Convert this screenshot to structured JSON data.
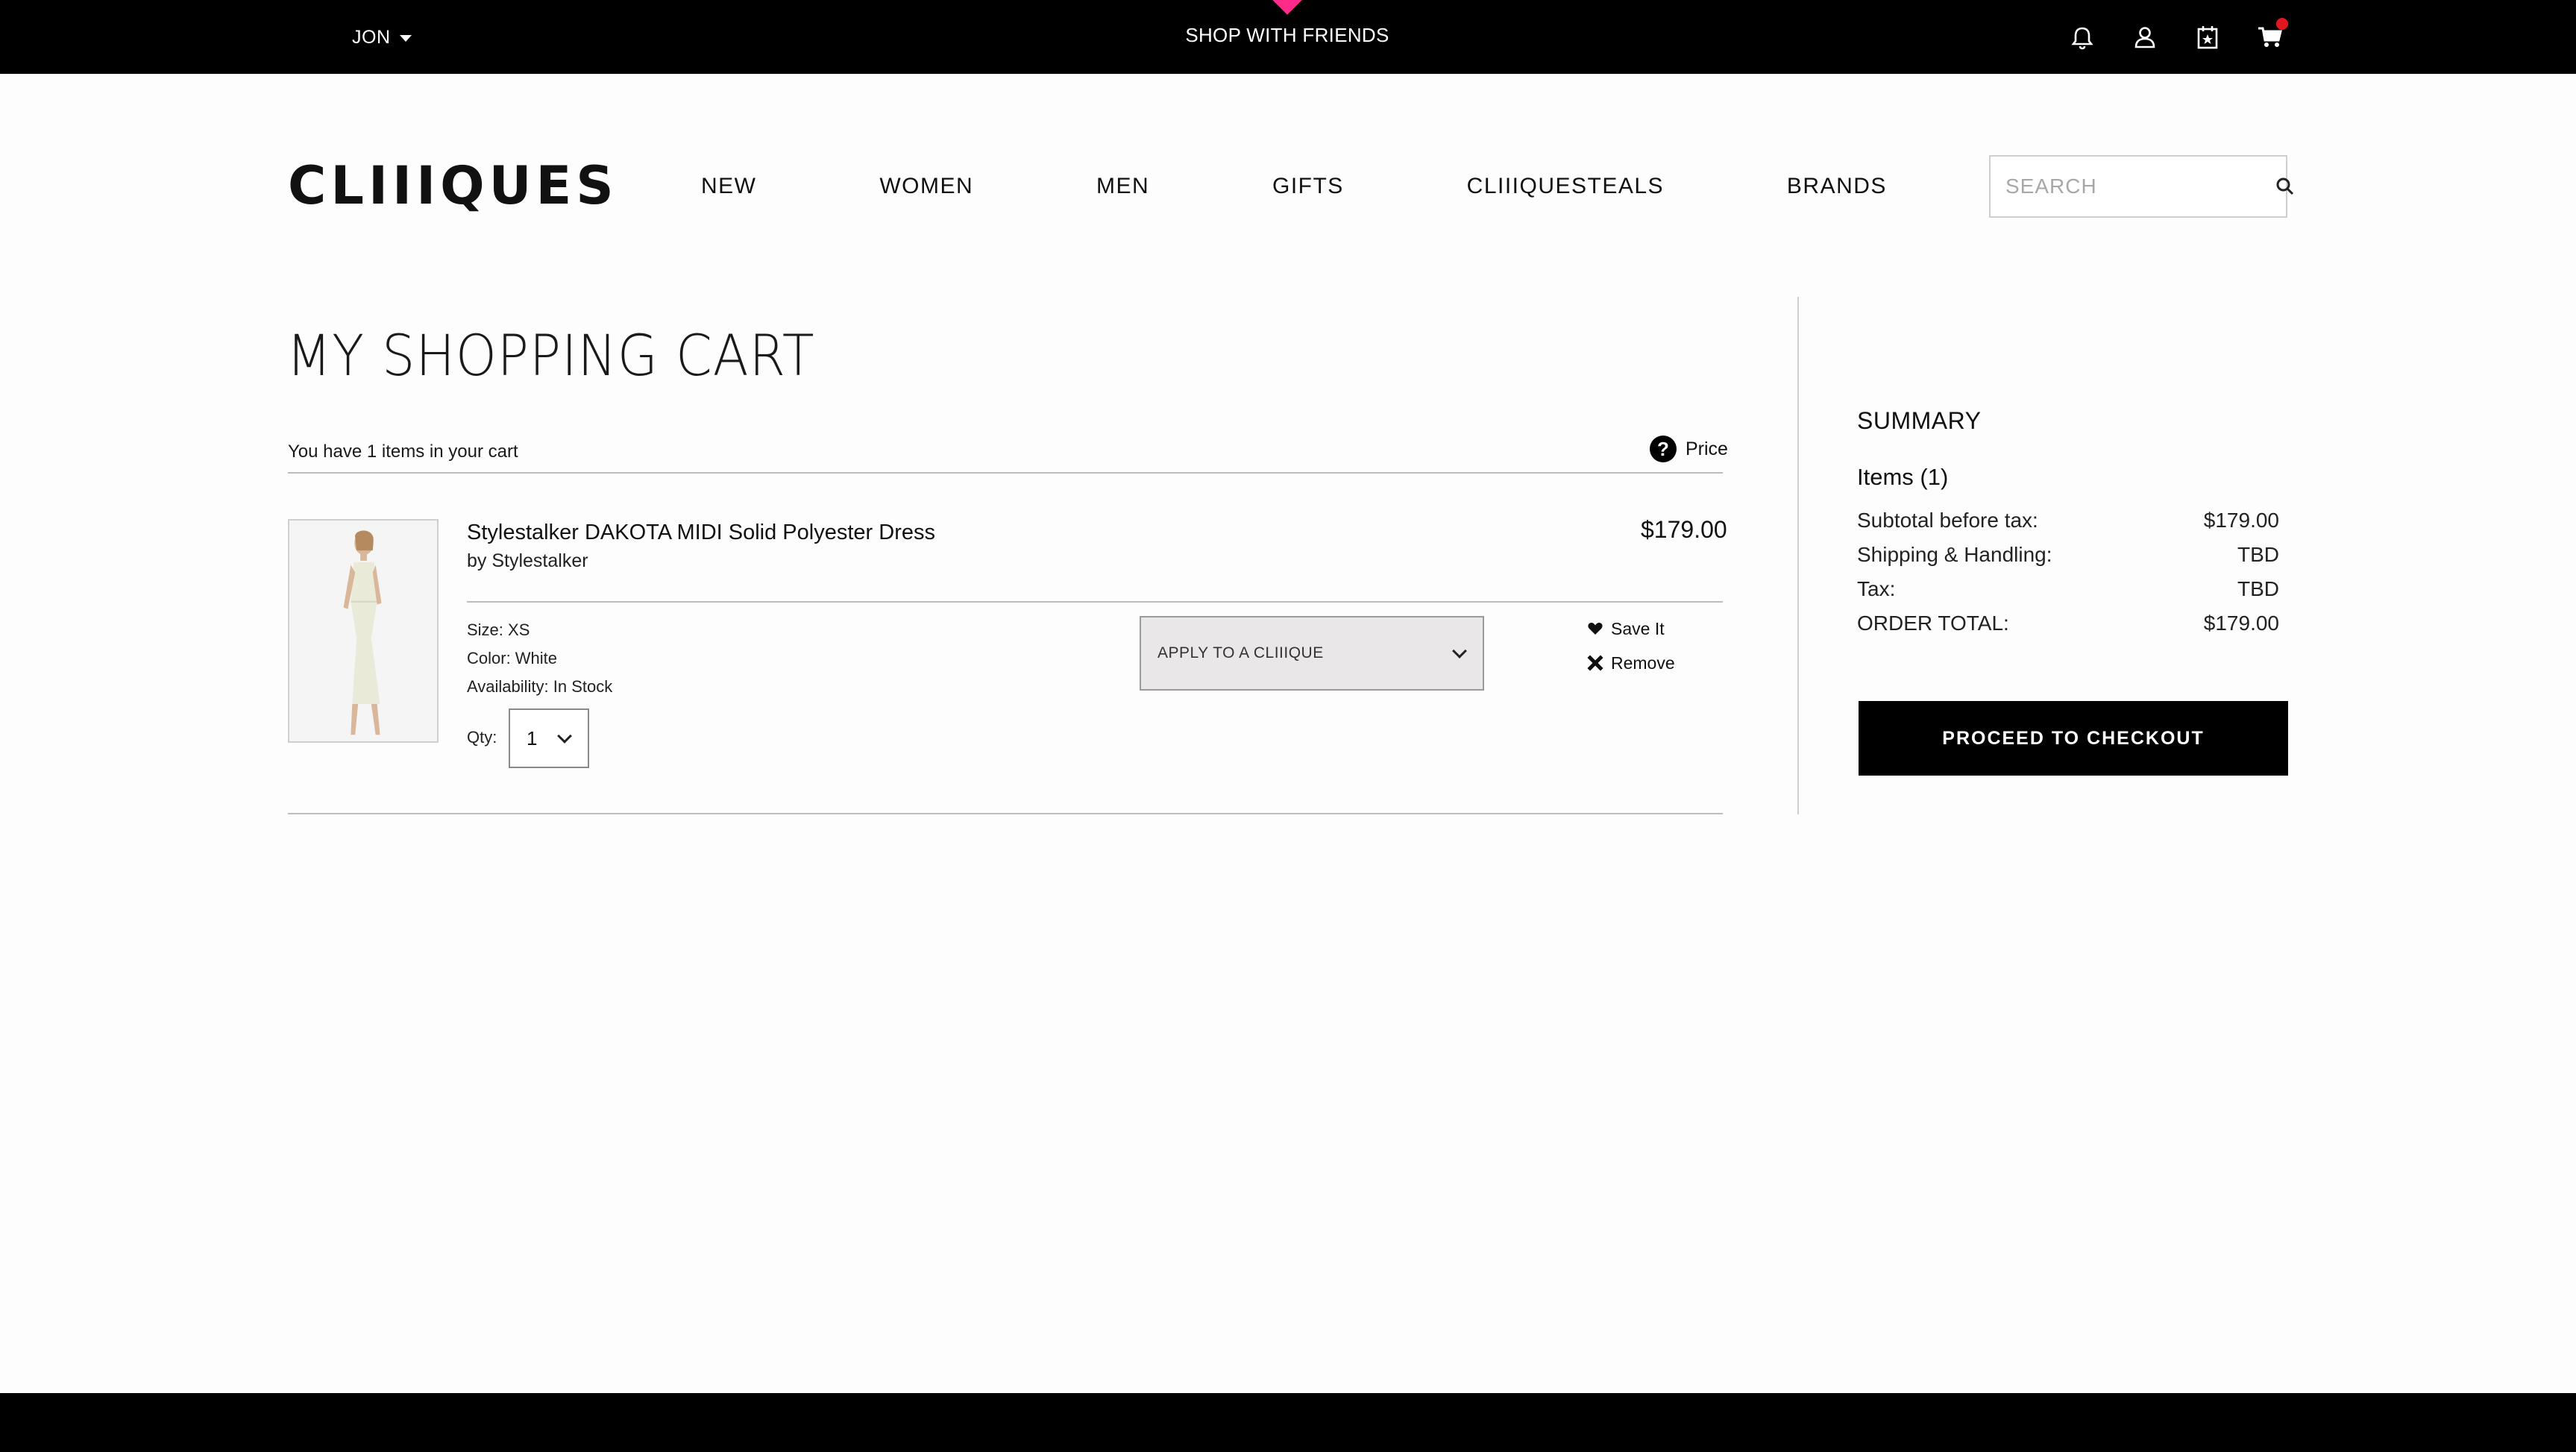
{
  "topbar": {
    "user_name": "JON",
    "promo": "SHOP WITH FRIENDS",
    "icons": [
      "bell-icon",
      "user-icon",
      "calendar-star-icon",
      "cart-icon"
    ],
    "cart_notification_color": "#e3151e"
  },
  "header": {
    "logo": "CLIIIQUES",
    "nav": [
      "NEW",
      "WOMEN",
      "MEN",
      "GIFTS",
      "CLIIIQUESTEALS",
      "BRANDS"
    ],
    "search_placeholder": "SEARCH"
  },
  "cart": {
    "title": "MY SHOPPING CART",
    "items_count_text": "You have 1 items in your cart",
    "price_heading": "Price",
    "items": [
      {
        "name": "Stylestalker DAKOTA MIDI Solid Polyester Dress",
        "brand": "by Stylestalker",
        "price": "$179.00",
        "size": "Size: XS",
        "color": "Color: White",
        "availability": "Availability: In Stock",
        "qty_label": "Qty:",
        "qty": "1",
        "clique_select": "APPLY TO A CLIIIQUE",
        "save_label": "Save It",
        "remove_label": "Remove"
      }
    ]
  },
  "summary": {
    "title": "SUMMARY",
    "items_label": "Items (1)",
    "rows": [
      {
        "label": "Subtotal before tax:",
        "value": "$179.00"
      },
      {
        "label": "Shipping & Handling:",
        "value": "TBD"
      },
      {
        "label": "Tax:",
        "value": "TBD"
      },
      {
        "label": "ORDER TOTAL:",
        "value": "$179.00"
      }
    ],
    "checkout_label": "PROCEED TO CHECKOUT"
  },
  "colors": {
    "accent_pink": "#ff2a8a",
    "bar_black": "#000000"
  }
}
